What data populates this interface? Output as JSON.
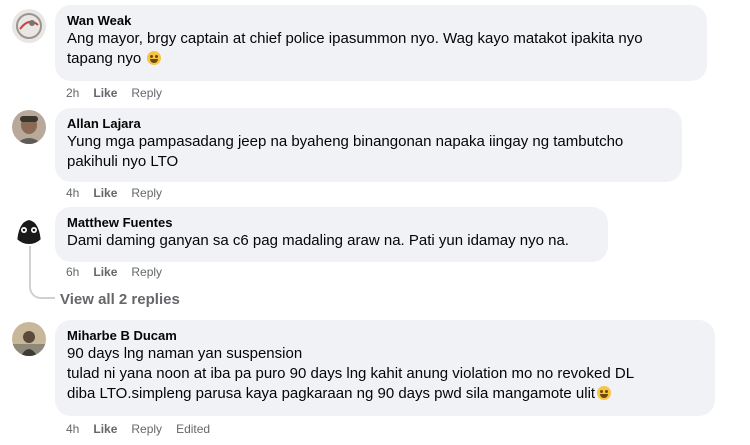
{
  "comments": [
    {
      "author": "Wan Weak",
      "text": "Ang mayor, brgy captain at chief police ipasummon nyo. Wag kayo matakot ipakita nyo\ntapang nyo",
      "emoji": "grinning-sweat-emoji",
      "time": "2h",
      "like": "Like",
      "reply": "Reply"
    },
    {
      "author": "Allan Lajara",
      "text": "Yung mga pampasadang jeep na byaheng binangonan napaka iingay ng tambutcho\npakihuli nyo LTO",
      "time": "4h",
      "like": "Like",
      "reply": "Reply"
    },
    {
      "author": "Matthew Fuentes",
      "text": "Dami daming ganyan sa c6 pag madaling araw na. Pati yun idamay nyo na.",
      "time": "6h",
      "like": "Like",
      "reply": "Reply"
    },
    {
      "author": "Miharbe B Ducam",
      "text": "90 days lng naman yan suspension\ntulad ni yana noon at iba pa puro 90 days lng kahit anung violation mo no revoked DL\ndiba LTO.simpleng parusa kaya pagkaraan ng 90 days pwd sila mangamote ulit",
      "emoji": "rolling-laughing-emoji",
      "time": "4h",
      "like": "Like",
      "reply": "Reply",
      "edited": "Edited"
    }
  ],
  "view_replies": "View all 2 replies",
  "colors": {
    "bubble": "#f0f2f5",
    "meta": "#65676b",
    "text": "#050505"
  }
}
